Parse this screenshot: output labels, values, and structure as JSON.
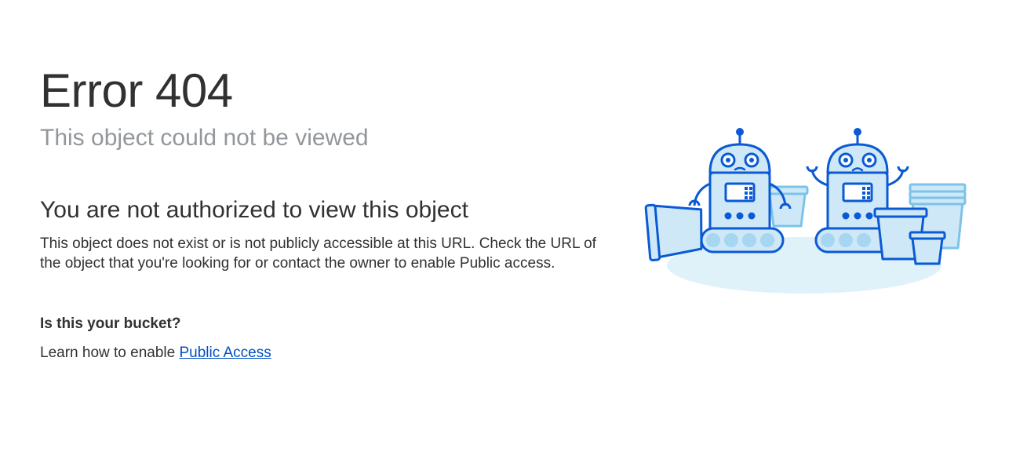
{
  "error": {
    "title": "Error 404",
    "subtitle": "This object could not be viewed"
  },
  "message": {
    "heading": "You are not authorized to view this object",
    "body": "This object does not exist or is not publicly accessible at this URL. Check the URL of the object that you're looking for or contact the owner to enable Public access."
  },
  "bucket": {
    "heading": "Is this your bucket?",
    "body_prefix": "Learn how to enable ",
    "link_label": "Public Access"
  },
  "colors": {
    "link": "#0051c3",
    "subtitle_gray": "#92979b",
    "text": "#313131",
    "robot_outline": "#0a5ad4",
    "robot_fill": "#cfe8f8",
    "floor": "#dff2fa"
  },
  "illustration": {
    "icons": [
      "robot-left-icon",
      "robot-right-icon",
      "bucket-icon"
    ]
  }
}
